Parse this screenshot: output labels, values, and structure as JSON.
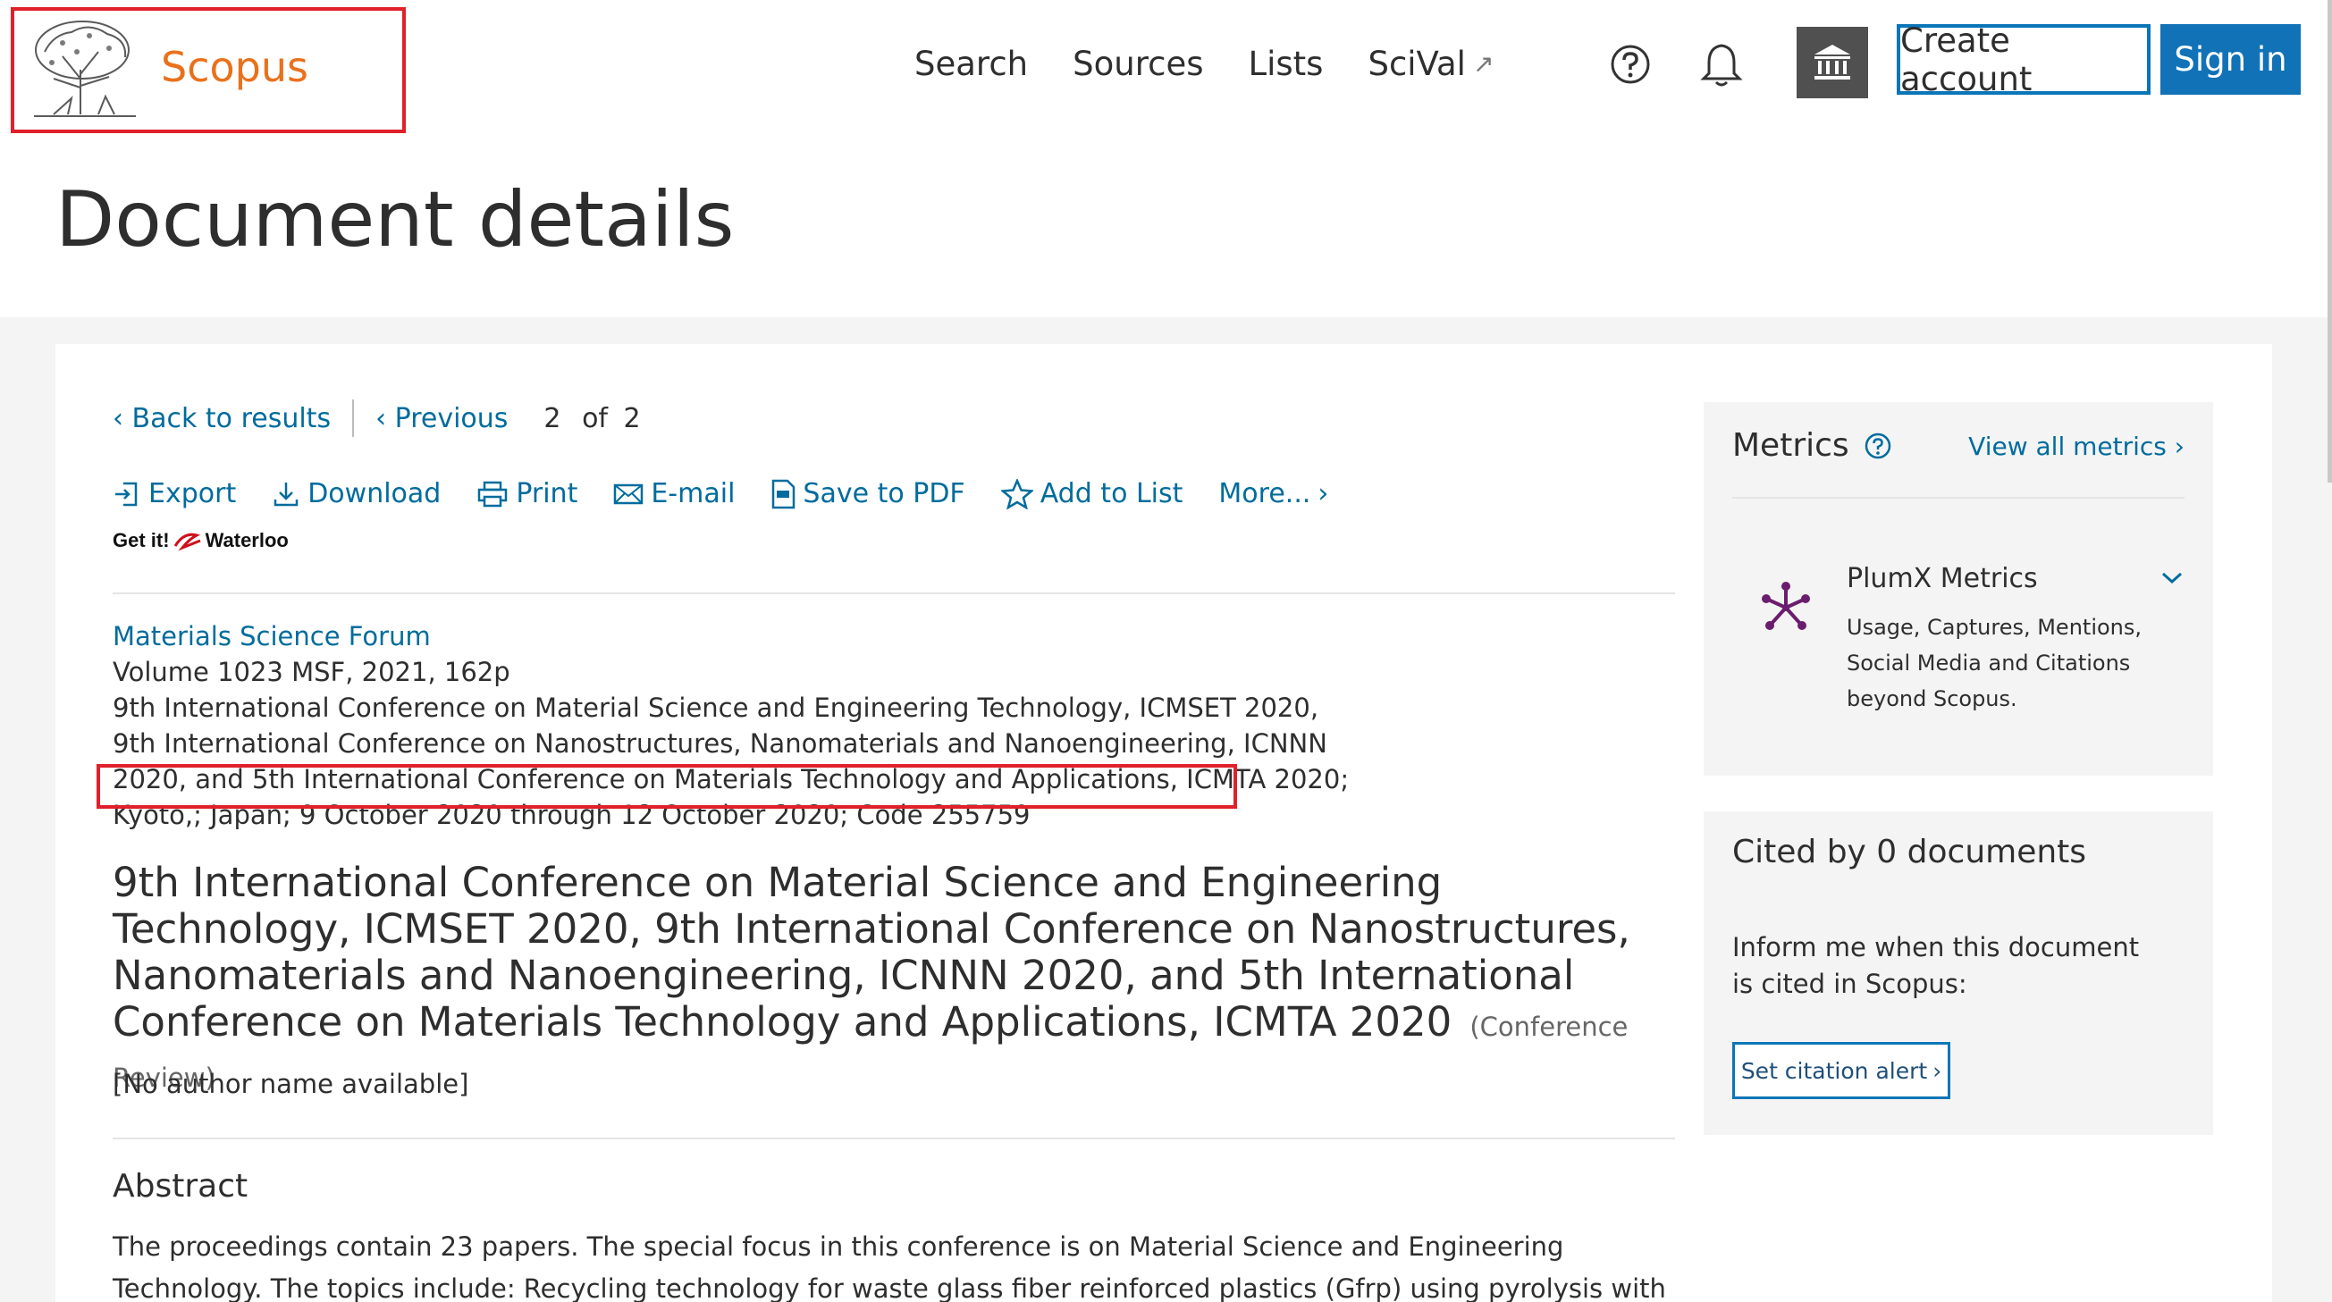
{
  "header": {
    "logo_text": "Scopus",
    "nav": [
      "Search",
      "Sources",
      "Lists",
      "SciVal"
    ],
    "create_account": "Create account",
    "sign_in": "Sign in"
  },
  "page_title": "Document details",
  "back_nav": {
    "back": "Back to results",
    "previous": "Previous",
    "current": "2",
    "of_label": "of",
    "total": "2"
  },
  "actions": [
    "Export",
    "Download",
    "Print",
    "E-mail",
    "Save to PDF",
    "Add to List",
    "More..."
  ],
  "getit": {
    "prefix": "Get it!",
    "brand": "Waterloo"
  },
  "meta": {
    "source_title": "Materials Science Forum",
    "volume": "Volume 1023 MSF, 2021, 162p",
    "conference": "9th International Conference on Material Science and Engineering Technology, ICMSET 2020, 9th International Conference on Nanostructures, Nanomaterials and Nanoengineering, ICNNN 2020, and 5th International Conference on Materials Technology and Applications, ICMTA 2020; Kyoto,; Japan; 9 October 2020 through 12 October 2020; Code 255759"
  },
  "doc": {
    "title": "9th International Conference on Material Science and Engineering Technology, ICMSET 2020, 9th International Conference on Nanostructures, Nanomaterials and Nanoengineering, ICNNN 2020, and 5th International Conference on Materials Technology and Applications, ICMTA 2020",
    "type": "(Conference Review)",
    "authors": "[No author name available]"
  },
  "abstract": {
    "heading": "Abstract",
    "text": "The proceedings contain 23 papers. The special focus in this conference is on Material Science and Engineering Technology. The topics include: Recycling technology for waste glass fiber reinforced plastics (Gfrp) using pyrolysis with naoh; synthesis of x-and a-"
  },
  "sidebar": {
    "metrics_title": "Metrics",
    "view_all": "View all metrics",
    "plumx_title": "PlumX Metrics",
    "plumx_desc": "Usage, Captures, Mentions, Social Media and Citations beyond Scopus.",
    "cited_title": "Cited by 0 documents",
    "cited_text": "Inform me when this document is cited in Scopus:",
    "alert_button": "Set citation alert"
  },
  "colors": {
    "brand_orange": "#e9711c",
    "link_blue": "#006c9d",
    "button_blue": "#1272b7",
    "highlight_red": "#e0202a",
    "plumx_purple": "#6b1d6e"
  }
}
